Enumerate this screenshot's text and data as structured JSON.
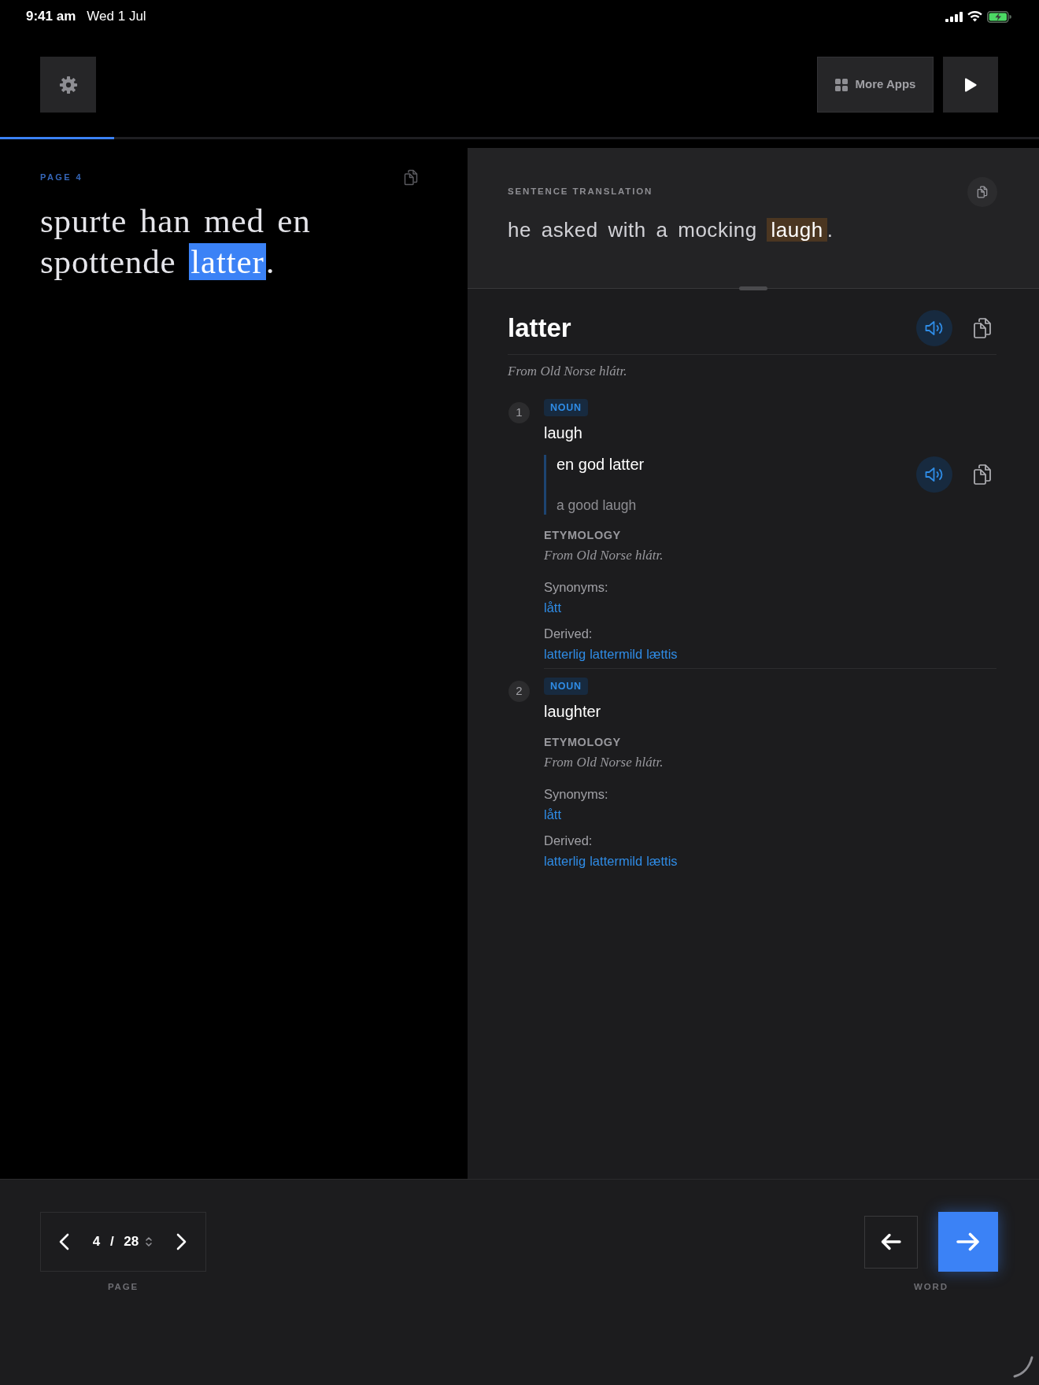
{
  "status_bar": {
    "time": "9:41 am",
    "date": "Wed 1 Jul"
  },
  "toolbar": {
    "more_apps": "More Apps"
  },
  "progress": {
    "level": 0.11
  },
  "source": {
    "page_label": "PAGE 4",
    "sentence": {
      "before": "spurte han med en spottende ",
      "highlight": "latter",
      "after": "."
    }
  },
  "translation": {
    "title": "SENTENCE TRANSLATION",
    "sentence": {
      "before": "he asked with a mocking ",
      "highlight": "laugh",
      "after": "."
    }
  },
  "entry": {
    "headword": "latter",
    "etymology": "From Old Norse hlátr.",
    "senses": [
      {
        "number": "1",
        "pos": "NOUN",
        "gloss": "laugh",
        "examples": [
          {
            "text": "en god latter",
            "translation": "a good laugh"
          }
        ],
        "etymology_label": "ETYMOLOGY",
        "etymology": "From Old Norse hlátr.",
        "synonyms_label": "Synonyms:",
        "synonyms": [
          "lått"
        ],
        "derived_label": "Derived:",
        "derived": [
          "latterlig",
          "lattermild",
          "lættis"
        ]
      },
      {
        "number": "2",
        "pos": "NOUN",
        "gloss": "laughter",
        "etymology_label": "ETYMOLOGY",
        "etymology": "From Old Norse hlátr.",
        "synonyms_label": "Synonyms:",
        "synonyms": [
          "lått"
        ],
        "derived_label": "Derived:",
        "derived": [
          "latterlig",
          "lattermild",
          "lættis"
        ]
      }
    ]
  },
  "pager": {
    "value": "4 / 28",
    "label": "PAGE"
  },
  "word_nav": {
    "label": "WORD"
  }
}
